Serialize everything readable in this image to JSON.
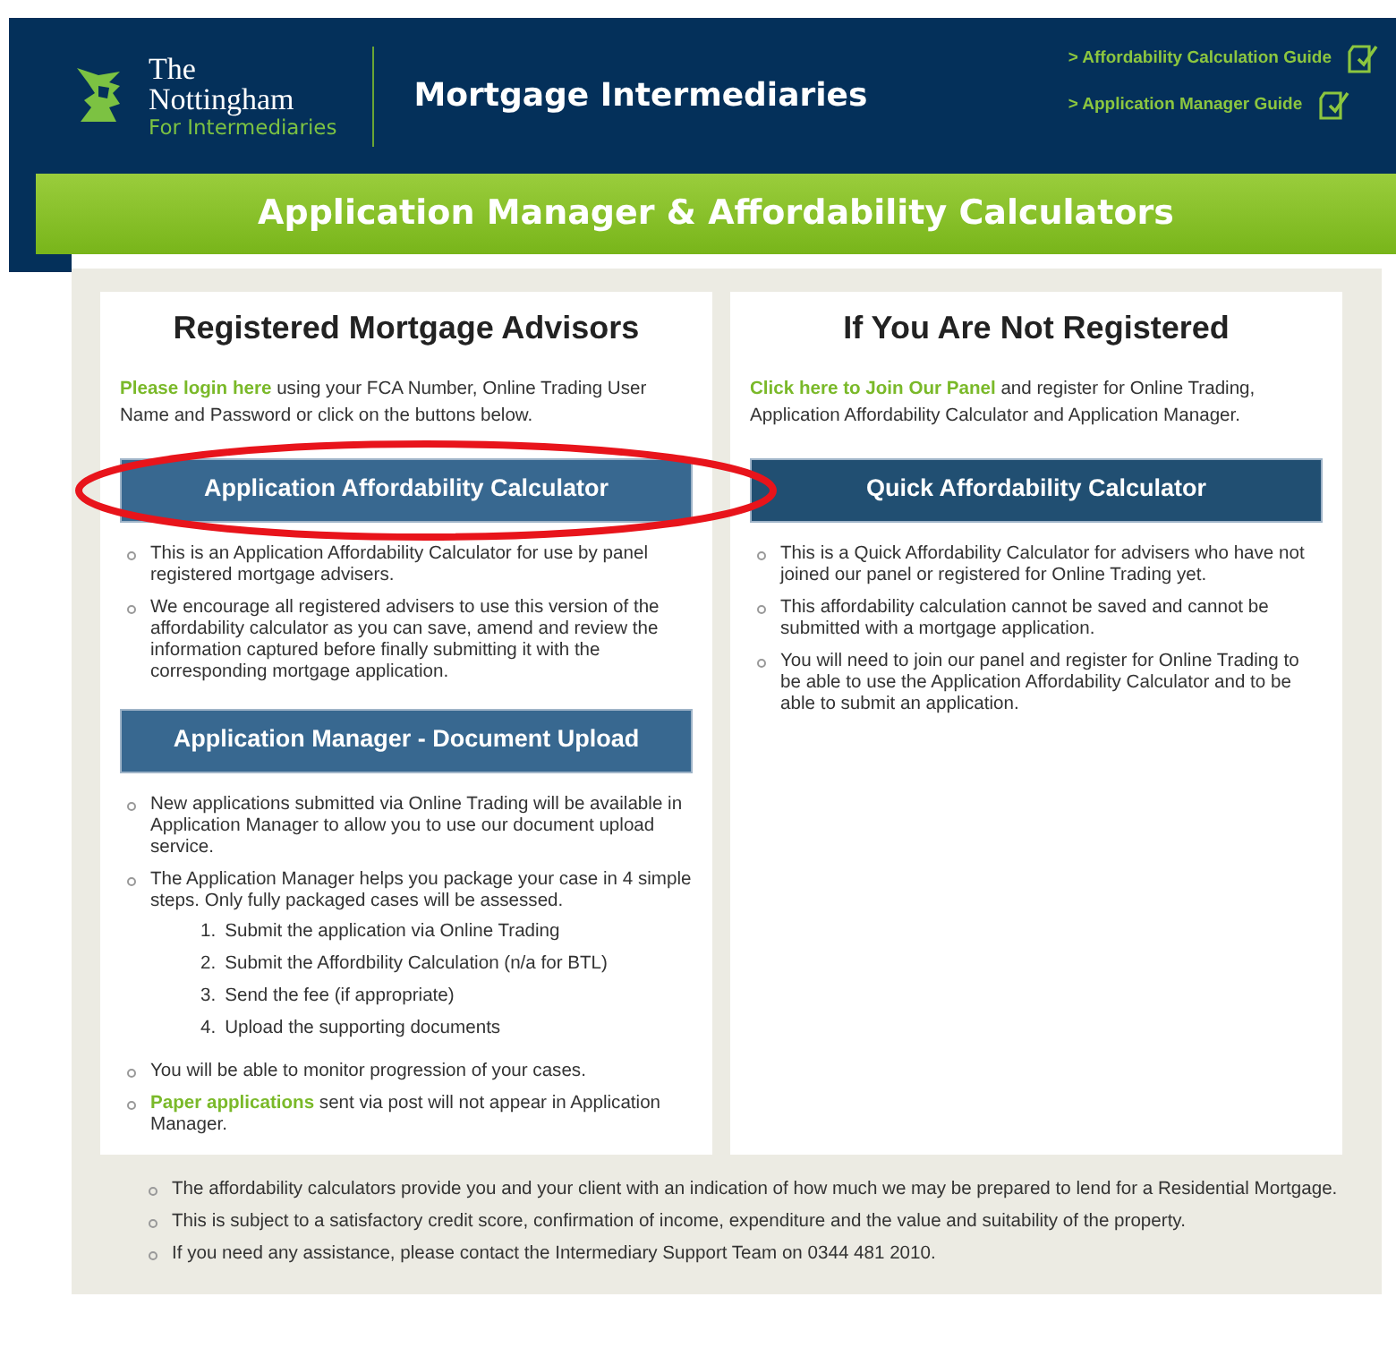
{
  "header": {
    "logo": {
      "line_1": "The",
      "line_2": "Nottingham",
      "tagline": "For Intermediaries"
    },
    "title": "Mortgage Intermediaries",
    "guide_links": [
      {
        "label": "> Affordability Calculation Guide"
      },
      {
        "label": "> Application Manager Guide"
      }
    ]
  },
  "banner": {
    "title": "Application Manager & Affordability Calculators"
  },
  "columns": [
    {
      "heading": "Registered Mortgage Advisors",
      "intro": {
        "link": "Please login here",
        "text": " using your FCA Number, Online Trading User Name and Password or click on the buttons below."
      },
      "sections": [
        {
          "button": "Application Affordability Calculator",
          "bullets": [
            {
              "text": "This is an Application Affordability Calculator for use by panel registered mortgage advisers."
            },
            {
              "text": "We encourage all registered advisers to use this version of the affordability calculator as you can save, amend and review the information captured before finally submitting it with the corresponding mortgage application."
            }
          ]
        },
        {
          "button": "Application Manager - Document Upload",
          "bullets": [
            {
              "text": "New applications submitted via Online Trading will be available in Application Manager to allow you to use our document upload service."
            },
            {
              "text": "The Application Manager helps you package your case in 4 simple steps. Only fully packaged cases will be assessed.",
              "steps": [
                {
                  "number": "1.",
                  "text": "Submit the application via Online Trading"
                },
                {
                  "number": "2.",
                  "text": "Submit the Affordbility Calculation (n/a for BTL)"
                },
                {
                  "number": "3.",
                  "text": "Send the fee (if appropriate)"
                },
                {
                  "number": "4.",
                  "text": "Upload the supporting documents"
                }
              ]
            },
            {
              "text": "You will be able to monitor progression of your cases."
            },
            {
              "link": "Paper applications",
              "text": " sent via post will not appear in Application Manager."
            }
          ]
        }
      ]
    },
    {
      "heading": "If You Are Not Registered",
      "intro": {
        "link": "Click here to Join Our Panel",
        "text": " and register for Online Trading, Application Affordability Calculator and Application Manager."
      },
      "sections": [
        {
          "button": "Quick Affordability Calculator",
          "bullets": [
            {
              "text": "This is a Quick Affordability Calculator for advisers who have not joined our panel or registered for Online Trading yet."
            },
            {
              "text": "This affordability calculation cannot be saved and cannot be submitted with a mortgage application."
            },
            {
              "text": "You will need to join our panel and register for Online Trading to be able to use the Application Affordability Calculator and to be able to submit an application."
            }
          ]
        }
      ]
    }
  ],
  "footer_notes": [
    {
      "text": "The affordability calculators provide you and your client with an indication of how much we may be prepared to lend for a Residential Mortgage."
    },
    {
      "text": "This is subject to a satisfactory credit score, confirmation of income, expenditure and the value and suitability of the property."
    },
    {
      "text": "If you need any assistance, please contact the Intermediary Support Team on 0344 481 2010."
    }
  ],
  "annotation": {
    "kind": "ellipse"
  }
}
